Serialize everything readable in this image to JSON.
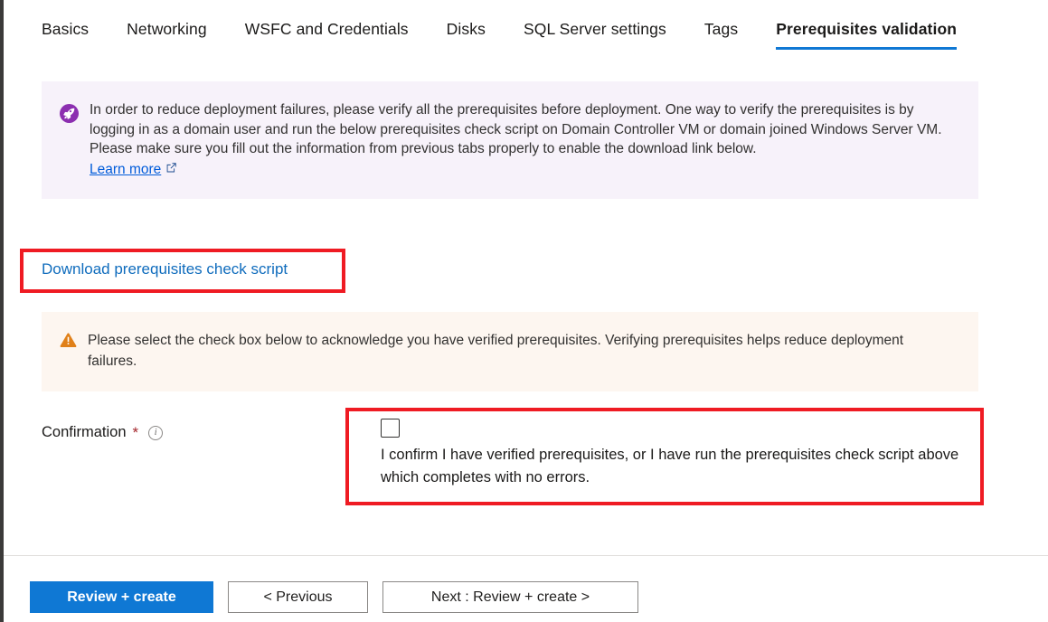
{
  "tabs": [
    {
      "label": "Basics",
      "active": false
    },
    {
      "label": "Networking",
      "active": false
    },
    {
      "label": "WSFC and Credentials",
      "active": false
    },
    {
      "label": "Disks",
      "active": false
    },
    {
      "label": "SQL Server settings",
      "active": false
    },
    {
      "label": "Tags",
      "active": false
    },
    {
      "label": "Prerequisites validation",
      "active": true
    }
  ],
  "info_banner": {
    "icon": "rocket-icon",
    "icon_color": "#8c2fb0",
    "background": "#f7f2fa",
    "text": "In order to reduce deployment failures, please verify all the prerequisites before deployment. One way to verify the prerequisites is by logging in as a domain user and run the below prerequisites check script on Domain Controller VM or domain joined Windows Server VM. Please make sure you fill out the information from previous tabs properly to enable the download link below.",
    "link_label": "Learn more",
    "link_icon": "external-link-icon",
    "link_color": "#015cda"
  },
  "download": {
    "label": "Download prerequisites check script",
    "color": "#0f6cbd",
    "highlight_color": "#ef1b23"
  },
  "warning_banner": {
    "icon": "warning-triangle-icon",
    "icon_color": "#d87c1e",
    "background": "#fdf6f0",
    "text": "Please select the check box below to acknowledge you have verified prerequisites. Verifying prerequisites helps reduce deployment failures."
  },
  "confirmation": {
    "label": "Confirmation",
    "required_marker": "*",
    "info_icon": "info-circle-icon",
    "info_glyph": "i",
    "checkbox_checked": false,
    "checkbox_text": "I confirm I have verified prerequisites, or I have run the prerequisites check script above which completes with no errors.",
    "highlight_color": "#ef1b23"
  },
  "footer": {
    "primary_button": "Review + create",
    "previous_button": "< Previous",
    "next_button": "Next : Review + create >",
    "primary_color": "#0f78d4"
  }
}
